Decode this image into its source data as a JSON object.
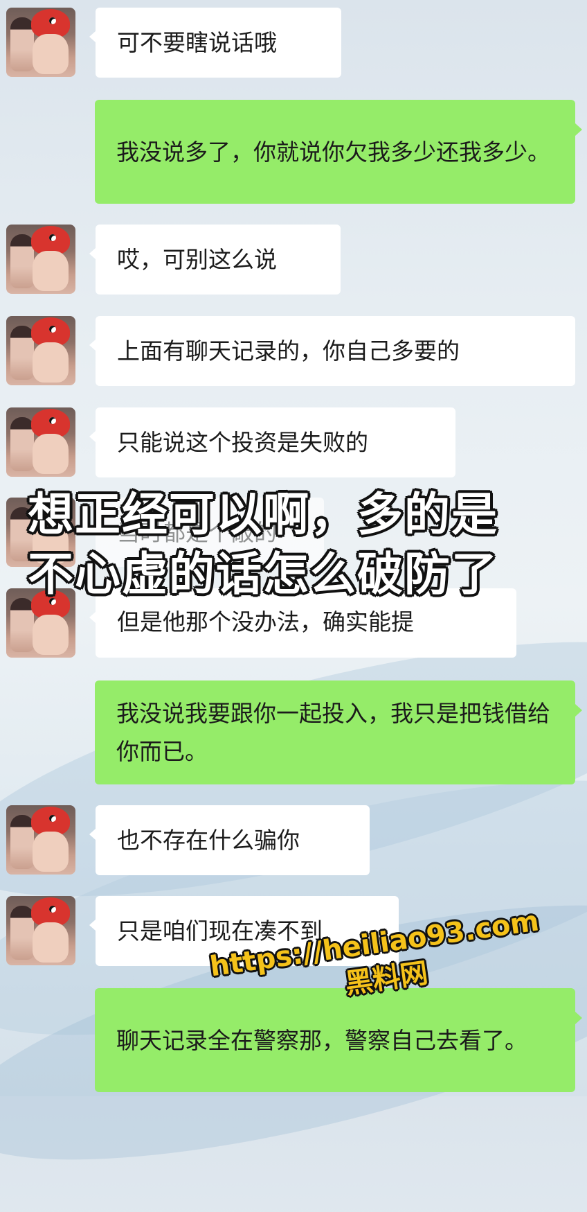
{
  "messages": [
    {
      "side": "received",
      "text": "可不要瞎说话哦"
    },
    {
      "side": "sent",
      "text": "我没说多了，你就说你欠我多少还我多少。"
    },
    {
      "side": "received",
      "text": "哎，可别这么说"
    },
    {
      "side": "received",
      "text": "上面有聊天记录的，你自己多要的"
    },
    {
      "side": "received",
      "text": "只能说这个投资是失败的"
    },
    {
      "side": "received",
      "text": "当时都是个敲的"
    },
    {
      "side": "received",
      "text": "但是他那个没办法，确实能提"
    },
    {
      "side": "sent",
      "text": "我没说我要跟你一起投入，我只是把钱借给你而已。"
    },
    {
      "side": "received",
      "text": "也不存在什么骗你"
    },
    {
      "side": "received",
      "text": "只是咱们现在凑不到"
    },
    {
      "side": "sent",
      "text": "聊天记录全在警察那，警察自己去看了。"
    }
  ],
  "overlay_caption": {
    "line1": "想正经可以啊，多的是",
    "line2": "不心虚的话怎么破防了"
  },
  "watermark": {
    "url": "https://heiliao93.com",
    "site_name": "黑料网"
  },
  "colors": {
    "sent_bubble": "#95ec69",
    "received_bubble": "#ffffff",
    "caption_text": "#ffffff",
    "watermark_text": "#f5c21a"
  }
}
